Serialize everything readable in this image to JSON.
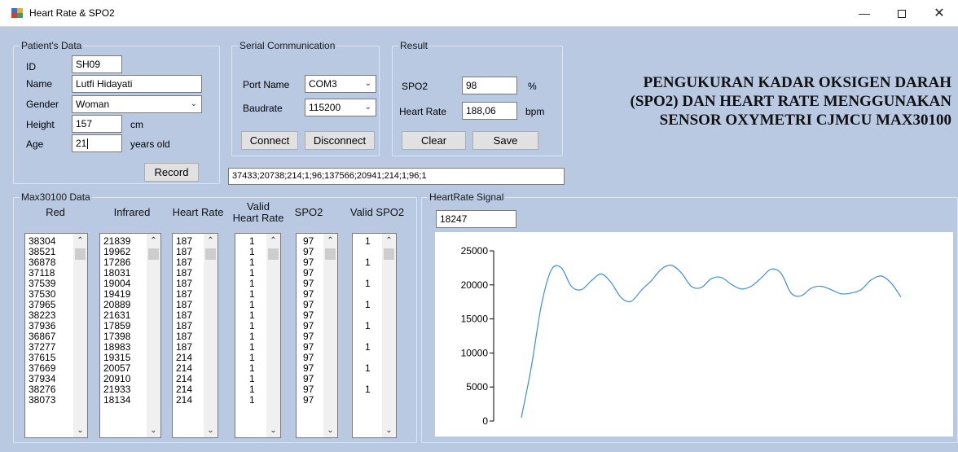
{
  "window": {
    "title": "Heart Rate & SPO2",
    "icon": "app-icon",
    "min_icon": "minimize-icon",
    "max_icon": "maximize-icon",
    "close_icon": "close-icon"
  },
  "patient": {
    "legend": "Patient's Data",
    "id_label": "ID",
    "id_value": "SH09",
    "name_label": "Name",
    "name_value": "Lutfi Hidayati",
    "gender_label": "Gender",
    "gender_value": "Woman",
    "height_label": "Height",
    "height_value": "157",
    "height_unit": "cm",
    "age_label": "Age",
    "age_value": "21",
    "age_unit": "years old",
    "record_button": "Record"
  },
  "serial": {
    "legend": "Serial Communication",
    "port_label": "Port Name",
    "port_value": "COM3",
    "baud_label": "Baudrate",
    "baud_value": "115200",
    "connect_button": "Connect",
    "disconnect_button": "Disconnect"
  },
  "result": {
    "legend": "Result",
    "spo2_label": "SPO2",
    "spo2_value": "98",
    "spo2_unit": "%",
    "hr_label": "Heart Rate",
    "hr_value": "188,06",
    "hr_unit": "bpm",
    "clear_button": "Clear",
    "save_button": "Save"
  },
  "headline": "PENGUKURAN KADAR OKSIGEN DARAH (SPO2) DAN HEART RATE MENGGUNAKAN SENSOR OXYMETRI CJMCU MAX30100",
  "raw_data": "37433;20738;214;1;96;137566;20941;214;1;96;1",
  "max_data": {
    "legend": "Max30100 Data",
    "headers": {
      "red": "Red",
      "infrared": "Infrared",
      "heart_rate": "Heart Rate",
      "valid_hr_line1": "Valid",
      "valid_hr_line2": "Heart Rate",
      "spo2": "SPO2",
      "valid_spo2": "Valid SPO2"
    },
    "red": [
      "38304",
      "38521",
      "36878",
      "37118",
      "37539",
      "37530",
      "37965",
      "38223",
      "37936",
      "36867",
      "37277",
      "37615",
      "37669",
      "37934",
      "38276",
      "38073"
    ],
    "infrared": [
      "21839",
      "19962",
      "17286",
      "18031",
      "19004",
      "19419",
      "20889",
      "21631",
      "17859",
      "17398",
      "18983",
      "19315",
      "20057",
      "20910",
      "21933",
      "18134"
    ],
    "heart_rate": [
      "187",
      "187",
      "187",
      "187",
      "187",
      "187",
      "187",
      "187",
      "187",
      "187",
      "187",
      "214",
      "214",
      "214",
      "214",
      "214"
    ],
    "valid_hr": [
      "1",
      "1",
      "1",
      "1",
      "1",
      "1",
      "1",
      "1",
      "1",
      "1",
      "1",
      "1",
      "1",
      "1",
      "1",
      "1"
    ],
    "spo2": [
      "97",
      "97",
      "97",
      "97",
      "97",
      "97",
      "97",
      "97",
      "97",
      "97",
      "97",
      "97",
      "97",
      "97",
      "97",
      "97"
    ],
    "valid_spo2": [
      "1",
      "",
      "1",
      "",
      "1",
      "",
      "1",
      "",
      "1",
      "",
      "1",
      "",
      "1",
      "",
      "1",
      ""
    ]
  },
  "signal": {
    "legend": "HeartRate Signal",
    "current_value": "18247"
  },
  "chart_data": {
    "type": "line",
    "title": "",
    "xlabel": "",
    "ylabel": "",
    "ylim": [
      0,
      25000
    ],
    "yticks": [
      "25000",
      "20000",
      "15000",
      "10000",
      "5000",
      "0"
    ],
    "grid": false,
    "color": "#3d8ee0",
    "series": [
      {
        "values": [
          500,
          8000,
          17000,
          22200,
          22500,
          19800,
          19300,
          20600,
          21600,
          20300,
          18100,
          17600,
          19200,
          20600,
          22300,
          22900,
          21800,
          19800,
          19600,
          20900,
          21100,
          20100,
          19400,
          19800,
          21000,
          22300,
          21700,
          18800,
          18400,
          19500,
          19800,
          19300,
          18700,
          18800,
          19300,
          20700,
          21300,
          20300,
          18200
        ]
      }
    ]
  }
}
